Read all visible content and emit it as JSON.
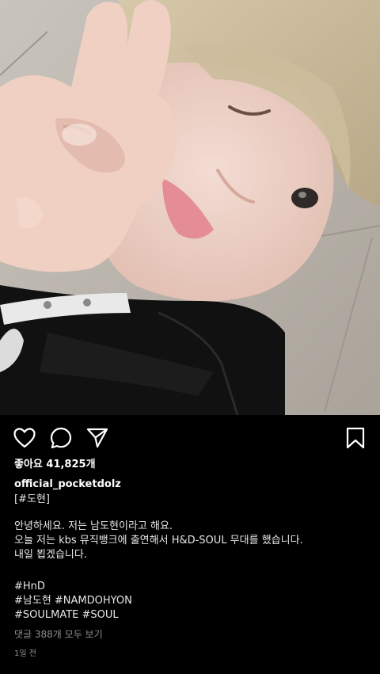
{
  "post": {
    "likes_text": "좋아요 41,825개",
    "username": "official_pocketdolz",
    "member_tag": "[#도현]",
    "caption_lines": [
      "안녕하세요. 저는 남도현이라고 해요.",
      "오늘 저는 kbs 뮤직뱅크에 출연해서 H&D-SOUL 무대를 했습니다.",
      "내일 뵙겠습니다."
    ],
    "hashtag_lines": [
      "#HnD",
      "#남도현 #NAMDOHYON",
      "#SOULMATE #SOUL"
    ],
    "view_comments": "댓글 388개 모두 보기",
    "time_ago": "1일 전"
  },
  "actions": {
    "like_icon": "heart-outline-icon",
    "comment_icon": "speech-bubble-icon",
    "share_icon": "paper-plane-icon",
    "save_icon": "bookmark-icon"
  },
  "colors": {
    "background": "#000000",
    "text": "#ffffff",
    "muted": "#8e8e8e"
  }
}
